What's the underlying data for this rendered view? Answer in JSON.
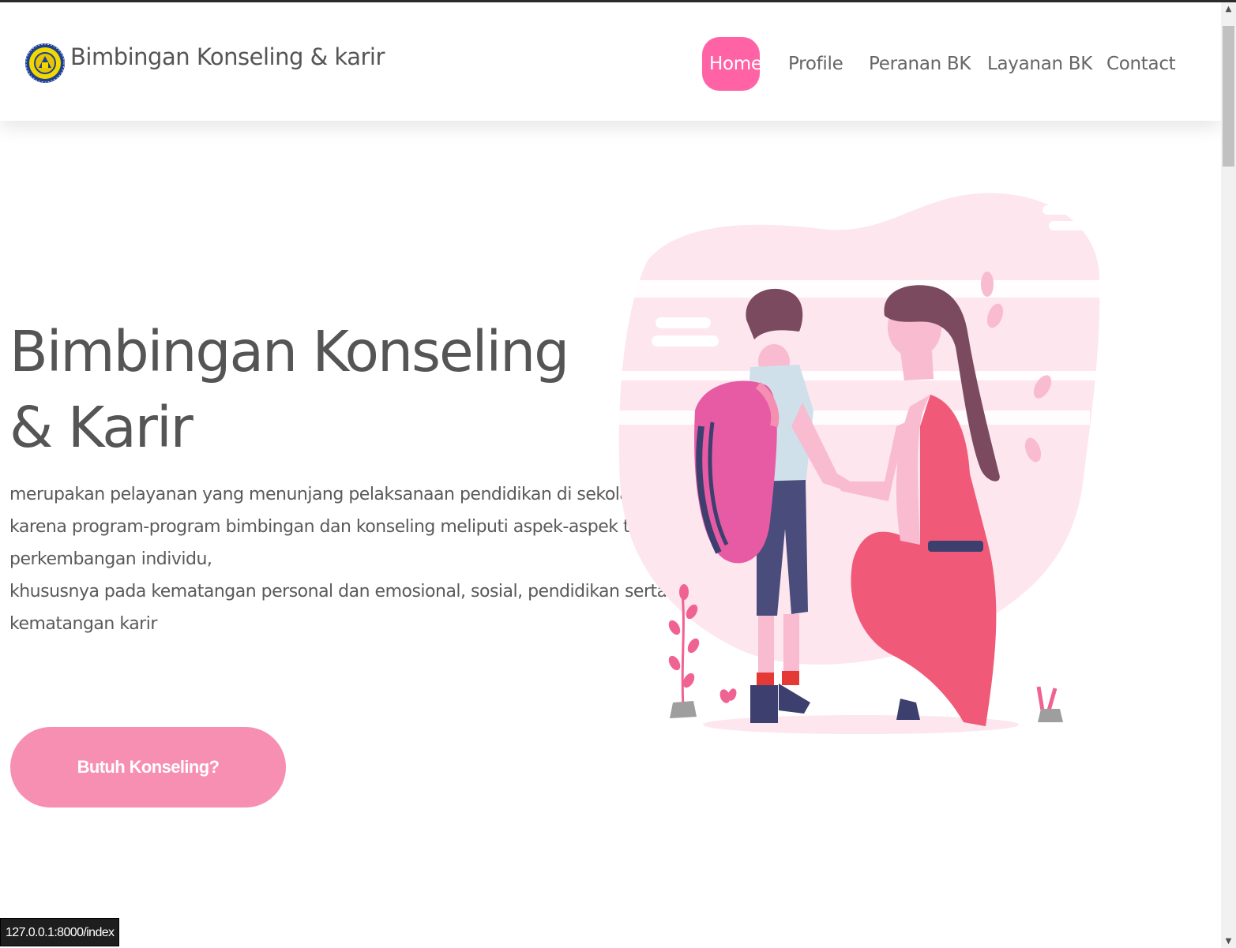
{
  "navbar": {
    "brand": "Bimbingan Konseling & karir",
    "items": [
      {
        "label": "Home",
        "active": true
      },
      {
        "label": "Profile",
        "active": false
      },
      {
        "label": "Peranan BK",
        "active": false
      },
      {
        "label": "Layanan BK",
        "active": false
      },
      {
        "label": "Contact",
        "active": false
      }
    ]
  },
  "hero": {
    "title_line1": "Bimbingan Konseling",
    "title_line2": "& Karir",
    "description_lines": [
      "merupakan pelayanan yang menunjang pelaksanaan pendidikan di sekolah,",
      "karena program-program bimbingan dan konseling meliputi aspek-aspek tugas",
      "perkembangan individu,",
      "khususnya pada kematangan personal dan emosional, sosial, pendidikan serta",
      "kematangan karir"
    ],
    "cta_label": "Butuh Konseling?"
  },
  "status_bar": {
    "url": "127.0.0.1:8000/index"
  },
  "colors": {
    "accent": "#ff63a5",
    "cta": "#f78fb3",
    "text": "#555555",
    "blob": "#fde6ee"
  },
  "icons": {
    "logo": "school-emblem-icon",
    "illustration": "mother-and-child-illustration"
  }
}
